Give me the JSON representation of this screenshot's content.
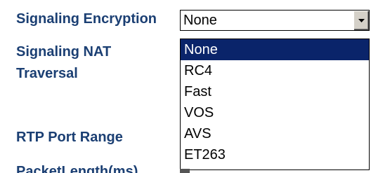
{
  "form": {
    "labels": {
      "signaling_encryption": "Signaling Encryption",
      "signaling_nat_line1": "Signaling NAT",
      "signaling_nat_line2": "Traversal",
      "rtp_port_range": "RTP Port Range",
      "packet_length": "PacketLength(ms)"
    }
  },
  "encryption_select": {
    "value": "None",
    "options": [
      "None",
      "RC4",
      "Fast",
      "VOS",
      "AVS",
      "ET263"
    ],
    "highlighted_option": "None"
  },
  "colors": {
    "label_text": "#1b3f73",
    "selection_highlight": "#0a246a",
    "arrow_button": "#d4d0c8"
  }
}
